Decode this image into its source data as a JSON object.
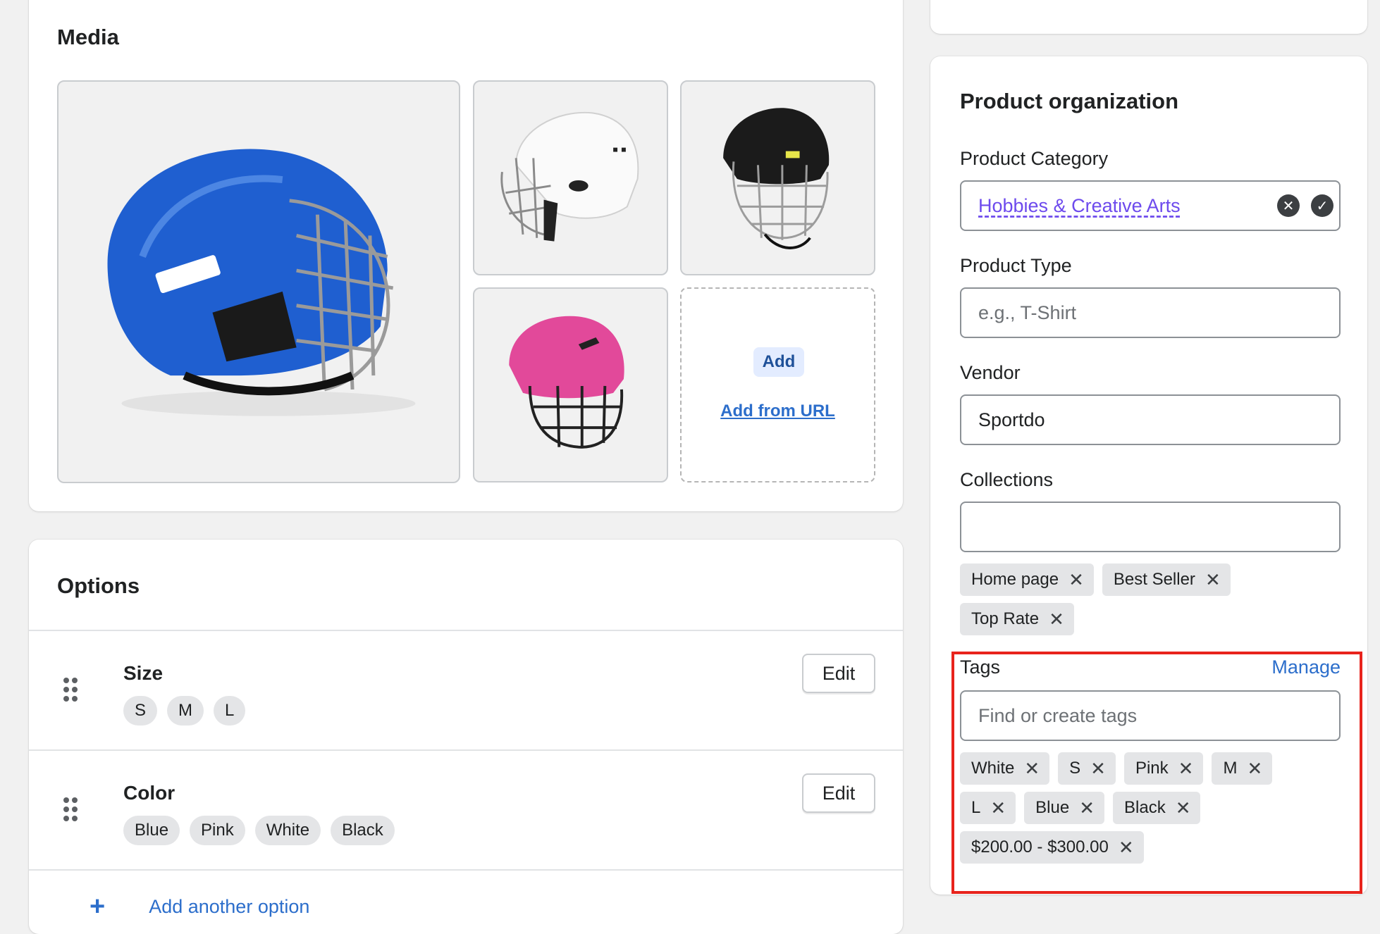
{
  "media": {
    "title": "Media",
    "add_label": "Add",
    "add_from_url_label": "Add from URL",
    "images": [
      {
        "name": "blue-helmet",
        "color": "#1f5fd0"
      },
      {
        "name": "white-helmet",
        "color": "#f4f4f4"
      },
      {
        "name": "black-helmet",
        "color": "#1b1b1b"
      },
      {
        "name": "pink-helmet",
        "color": "#e2499a"
      }
    ]
  },
  "options": {
    "title": "Options",
    "edit_label": "Edit",
    "items": [
      {
        "name": "Size",
        "values": [
          "S",
          "M",
          "L"
        ]
      },
      {
        "name": "Color",
        "values": [
          "Blue",
          "Pink",
          "White",
          "Black"
        ]
      }
    ],
    "add_option_label": "Add another option"
  },
  "organization": {
    "title": "Product organization",
    "category": {
      "label": "Product Category",
      "value": "Hobbies & Creative Arts"
    },
    "type": {
      "label": "Product Type",
      "placeholder": "e.g., T-Shirt"
    },
    "vendor": {
      "label": "Vendor",
      "value": "Sportdo"
    },
    "collections": {
      "label": "Collections",
      "items": [
        "Home page",
        "Best Seller",
        "Top Rate"
      ]
    },
    "tags": {
      "label": "Tags",
      "manage_label": "Manage",
      "placeholder": "Find or create tags",
      "items": [
        "White",
        "S",
        "Pink",
        "M",
        "L",
        "Blue",
        "Black",
        "$200.00 - $300.00"
      ]
    }
  },
  "colors": {
    "accent_link": "#2c6ecb",
    "category_link": "#6d4aed",
    "highlight_box": "#e8231c"
  }
}
